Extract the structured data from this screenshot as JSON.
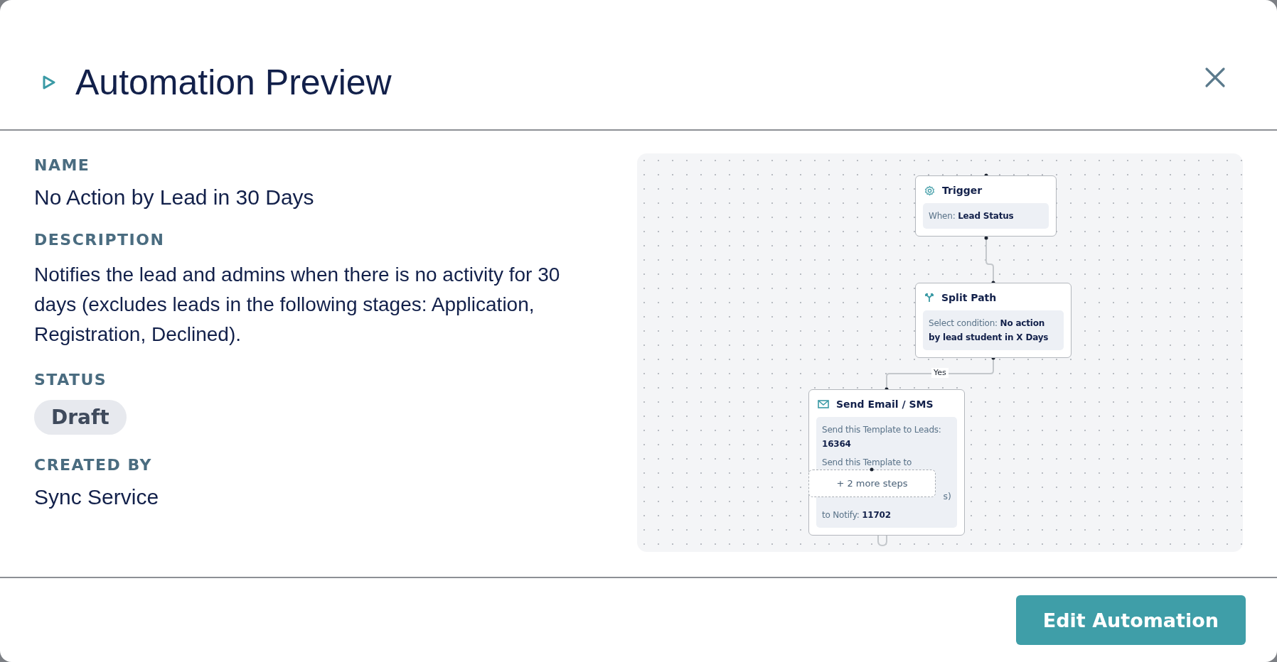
{
  "header": {
    "title": "Automation Preview"
  },
  "details": [
    {
      "kind": "text",
      "label": "NAME",
      "value": "No Action by Lead in 30 Days"
    },
    {
      "kind": "paragraph",
      "label": "DESCRIPTION",
      "value": "Notifies the lead and admins when there is no activity for 30 days (excludes leads in the following stages: Application, Registration, Declined)."
    },
    {
      "kind": "badge",
      "label": "STATUS",
      "value": "Draft"
    },
    {
      "kind": "text",
      "label": "CREATED BY",
      "value": "Sync Service"
    }
  ],
  "flow": {
    "nodes": [
      {
        "kind": "trigger",
        "title": "Trigger",
        "lines": [
          {
            "kind": "line",
            "text": "When: **Lead Status**"
          }
        ]
      },
      {
        "kind": "split",
        "title": "Split Path",
        "lines": [
          {
            "kind": "line",
            "text": "Select condition: **No action by lead student in X Days**"
          }
        ]
      },
      {
        "kind": "email",
        "title": "Send Email / SMS",
        "lines": [
          {
            "kind": "line",
            "text": "Send this Template to Leads: **16364**"
          },
          {
            "kind": "line",
            "text": "Send this Template to"
          },
          {
            "kind": "fragment",
            "text": "s)"
          },
          {
            "kind": "line",
            "text": "to Notify: **11702**"
          }
        ]
      }
    ],
    "edge_label": "Yes",
    "more_steps": "+ 2 more steps"
  },
  "footer": {
    "button": "Edit Automation"
  }
}
